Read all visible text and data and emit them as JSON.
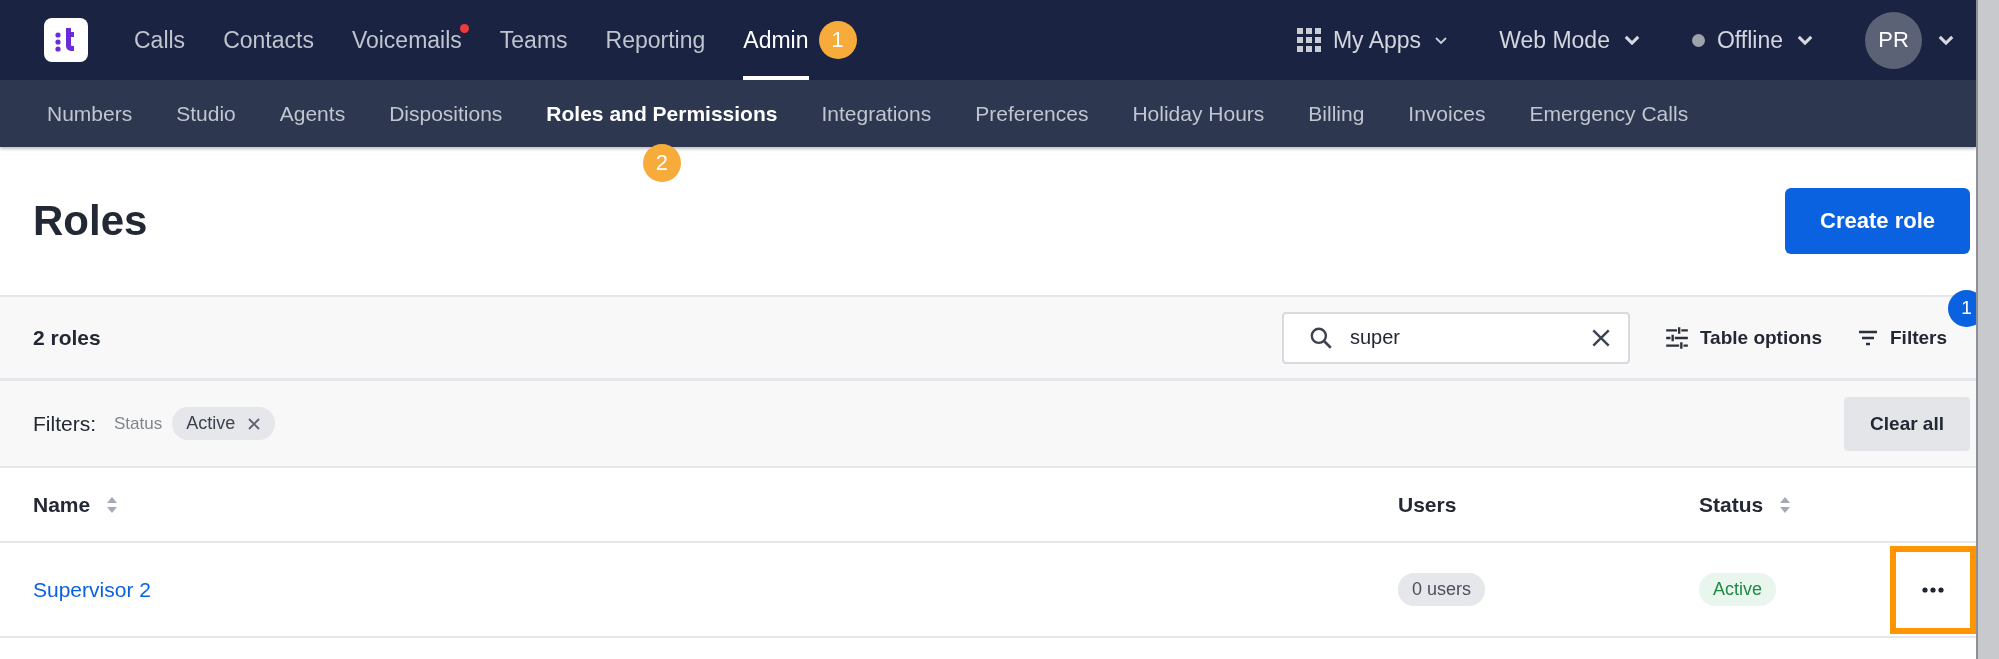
{
  "top_nav": {
    "items": [
      {
        "label": "Calls",
        "selected": false,
        "notification": false
      },
      {
        "label": "Contacts",
        "selected": false,
        "notification": false
      },
      {
        "label": "Voicemails",
        "selected": false,
        "notification": true
      },
      {
        "label": "Teams",
        "selected": false,
        "notification": false
      },
      {
        "label": "Reporting",
        "selected": false,
        "notification": false
      },
      {
        "label": "Admin",
        "selected": true,
        "notification": false,
        "marker": "1"
      }
    ],
    "my_apps": "My Apps",
    "mode": "Web Mode",
    "presence": "Offline",
    "avatar": "PR"
  },
  "sub_nav": {
    "items": [
      {
        "label": "Numbers",
        "selected": false
      },
      {
        "label": "Studio",
        "selected": false
      },
      {
        "label": "Agents",
        "selected": false
      },
      {
        "label": "Dispositions",
        "selected": false
      },
      {
        "label": "Roles and Permissions",
        "selected": true,
        "marker": "2"
      },
      {
        "label": "Integrations",
        "selected": false
      },
      {
        "label": "Preferences",
        "selected": false
      },
      {
        "label": "Holiday Hours",
        "selected": false
      },
      {
        "label": "Billing",
        "selected": false
      },
      {
        "label": "Invoices",
        "selected": false
      },
      {
        "label": "Emergency Calls",
        "selected": false
      }
    ]
  },
  "page": {
    "title": "Roles",
    "primary_button": "Create role"
  },
  "toolbar": {
    "count": "2 roles",
    "search": {
      "value": "super"
    },
    "table_options": "Table options",
    "filters": {
      "label": "Filters",
      "badge": "1"
    }
  },
  "filter_bar": {
    "label": "Filters:",
    "chips": [
      {
        "field": "Status",
        "value": "Active"
      }
    ],
    "clear": "Clear all"
  },
  "table": {
    "columns": [
      {
        "label": "Name",
        "sortable": true
      },
      {
        "label": "Users",
        "sortable": false
      },
      {
        "label": "Status",
        "sortable": true
      }
    ],
    "rows": [
      {
        "name": "Supervisor 2",
        "users": "0 users",
        "status": "Active",
        "actions_highlighted": true
      }
    ]
  }
}
